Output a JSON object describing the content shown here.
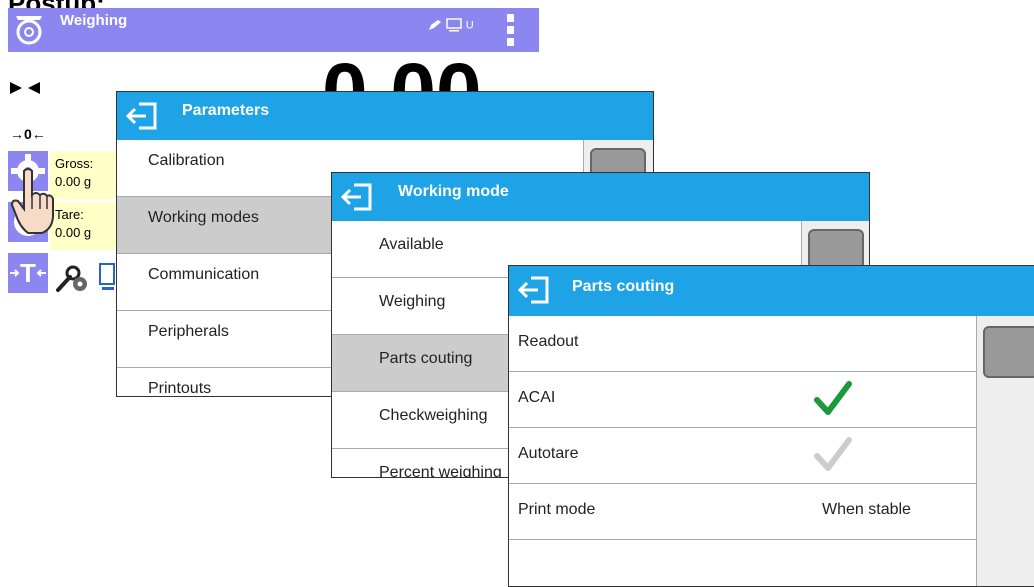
{
  "step_heading": "Postup:",
  "weighing_screen": {
    "title": "Weighing",
    "status_text": "U",
    "reading": "0.00",
    "gross": {
      "label": "Gross:",
      "value": "0.00 g"
    },
    "tare": {
      "label": "Tare:",
      "value": "0.00 g"
    },
    "zero_indicator": "→0←",
    "tare_key_symbol": "T",
    "colors": {
      "header": "#8c86f0",
      "info_box": "#ffffc8"
    },
    "icons": [
      "scale-icon",
      "pencil-icon",
      "monitor-icon",
      "menu-dots-icon",
      "stable-indicator-icon",
      "zero-indicator-icon",
      "gear-icon",
      "hand-pointer-icon",
      "tare-icon",
      "tools-icon"
    ]
  },
  "parameters_panel": {
    "title": "Parameters",
    "items": [
      "Calibration",
      "Working modes",
      "Communication",
      "Peripherals",
      "Printouts"
    ],
    "selected": "Working modes"
  },
  "working_mode_panel": {
    "title": "Working mode",
    "items": [
      "Available",
      "Weighing",
      "Parts couting",
      "Checkweighing",
      "Percent weighing"
    ],
    "selected": "Parts couting"
  },
  "parts_counting_panel": {
    "title": "Parts couting",
    "rows": [
      {
        "label": "Readout",
        "value": ""
      },
      {
        "label": "ACAI",
        "value": "",
        "check": "enabled"
      },
      {
        "label": "Autotare",
        "value": "",
        "check": "disabled"
      },
      {
        "label": "Print mode",
        "value": "When stable"
      },
      {
        "label": "",
        "value": ""
      }
    ]
  },
  "colors": {
    "dialog_bar": "#1ea3e6",
    "selected_row": "#cccccc",
    "check_on": "#1a9a3a",
    "check_off": "#cccccc"
  }
}
